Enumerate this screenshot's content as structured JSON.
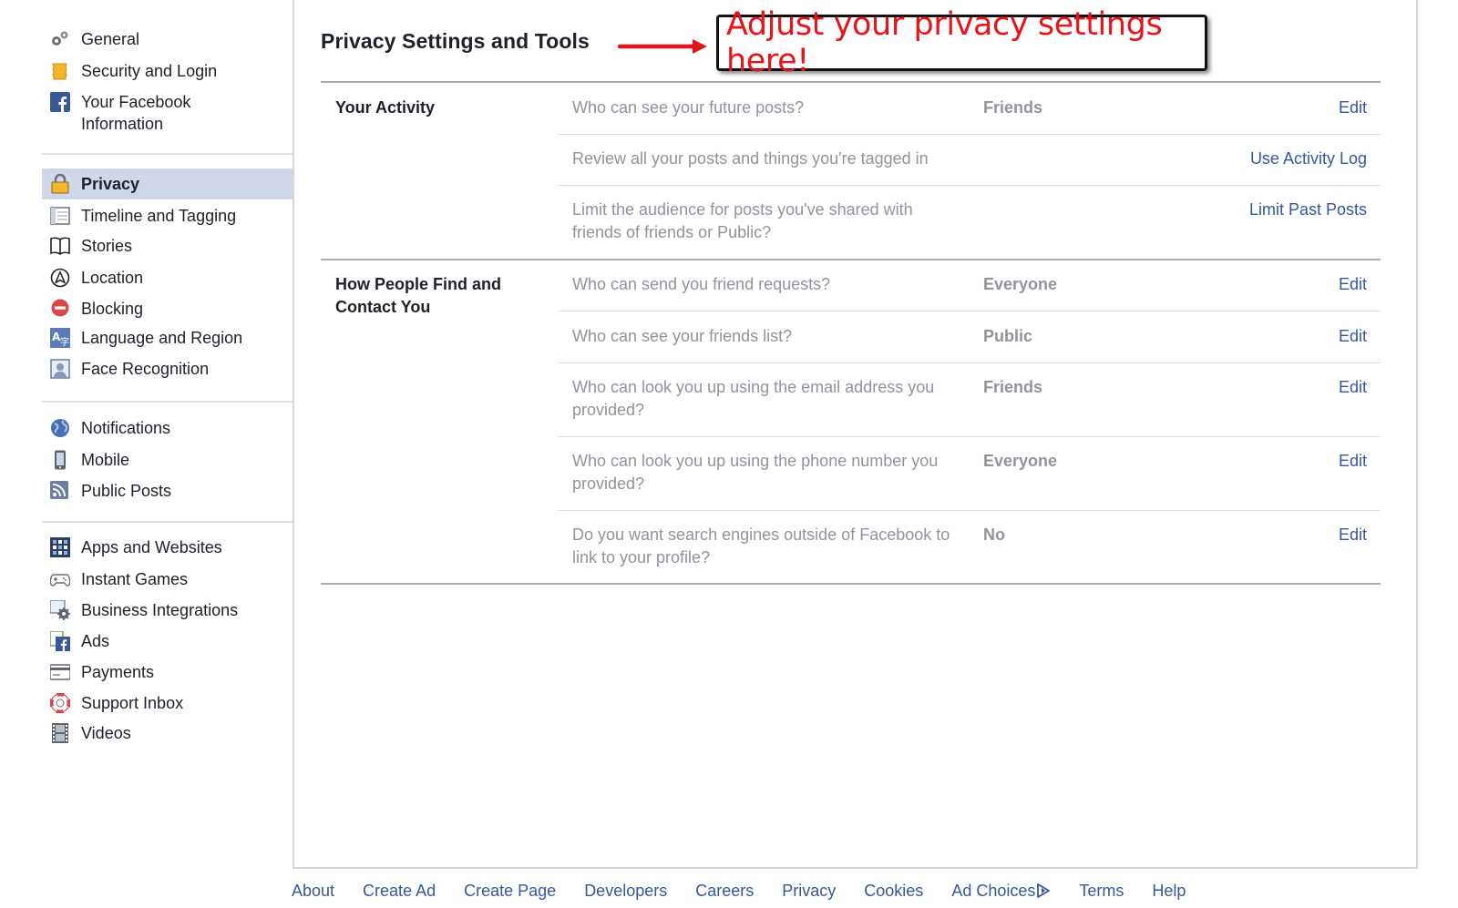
{
  "sidebar": {
    "groups": [
      [
        {
          "label": "General",
          "icon": "gears-icon"
        },
        {
          "label": "Security and Login",
          "icon": "badge-icon"
        },
        {
          "label": "Your Facebook Information",
          "icon": "facebook-icon"
        }
      ],
      [
        {
          "label": "Privacy",
          "icon": "lock-icon",
          "active": true
        },
        {
          "label": "Timeline and Tagging",
          "icon": "timeline-icon"
        },
        {
          "label": "Stories",
          "icon": "book-icon"
        },
        {
          "label": "Location",
          "icon": "location-icon"
        },
        {
          "label": "Blocking",
          "icon": "blocking-icon"
        },
        {
          "label": "Language and Region",
          "icon": "language-icon"
        },
        {
          "label": "Face Recognition",
          "icon": "face-recognition-icon"
        }
      ],
      [
        {
          "label": "Notifications",
          "icon": "globe-icon"
        },
        {
          "label": "Mobile",
          "icon": "mobile-icon"
        },
        {
          "label": "Public Posts",
          "icon": "rss-icon"
        }
      ],
      [
        {
          "label": "Apps and Websites",
          "icon": "apps-icon"
        },
        {
          "label": "Instant Games",
          "icon": "gamepad-icon"
        },
        {
          "label": "Business Integrations",
          "icon": "business-gear-icon"
        },
        {
          "label": "Ads",
          "icon": "ads-icon"
        },
        {
          "label": "Payments",
          "icon": "credit-card-icon"
        },
        {
          "label": "Support Inbox",
          "icon": "lifebuoy-icon"
        },
        {
          "label": "Videos",
          "icon": "film-icon"
        }
      ]
    ]
  },
  "main": {
    "title": "Privacy Settings and Tools",
    "callout": "Adjust your privacy settings here!",
    "sections": [
      {
        "title": "Your Activity",
        "rows": [
          {
            "question": "Who can see your future posts?",
            "value": "Friends",
            "action": "Edit"
          },
          {
            "question": "Review all your posts and things you're tagged in",
            "value": "",
            "action": "Use Activity Log"
          },
          {
            "question": "Limit the audience for posts you've shared with friends of friends or Public?",
            "value": "",
            "action": "Limit Past Posts"
          }
        ]
      },
      {
        "title": "How People Find and Contact You",
        "rows": [
          {
            "question": "Who can send you friend requests?",
            "value": "Everyone",
            "action": "Edit"
          },
          {
            "question": "Who can see your friends list?",
            "value": "Public",
            "action": "Edit"
          },
          {
            "question": "Who can look you up using the email address you provided?",
            "value": "Friends",
            "action": "Edit"
          },
          {
            "question": "Who can look you up using the phone number you provided?",
            "value": "Everyone",
            "action": "Edit"
          },
          {
            "question": "Do you want search engines outside of Facebook to link to your profile?",
            "value": "No",
            "action": "Edit"
          }
        ]
      }
    ]
  },
  "footer": {
    "links": [
      "About",
      "Create Ad",
      "Create Page",
      "Developers",
      "Careers",
      "Privacy",
      "Cookies",
      "Ad Choices",
      "Terms",
      "Help"
    ]
  },
  "colors": {
    "link": "#365899",
    "muted": "#90949c",
    "active_bg": "#cfd7e8",
    "callout_text": "#e8141a",
    "arrow": "#e8141a"
  }
}
